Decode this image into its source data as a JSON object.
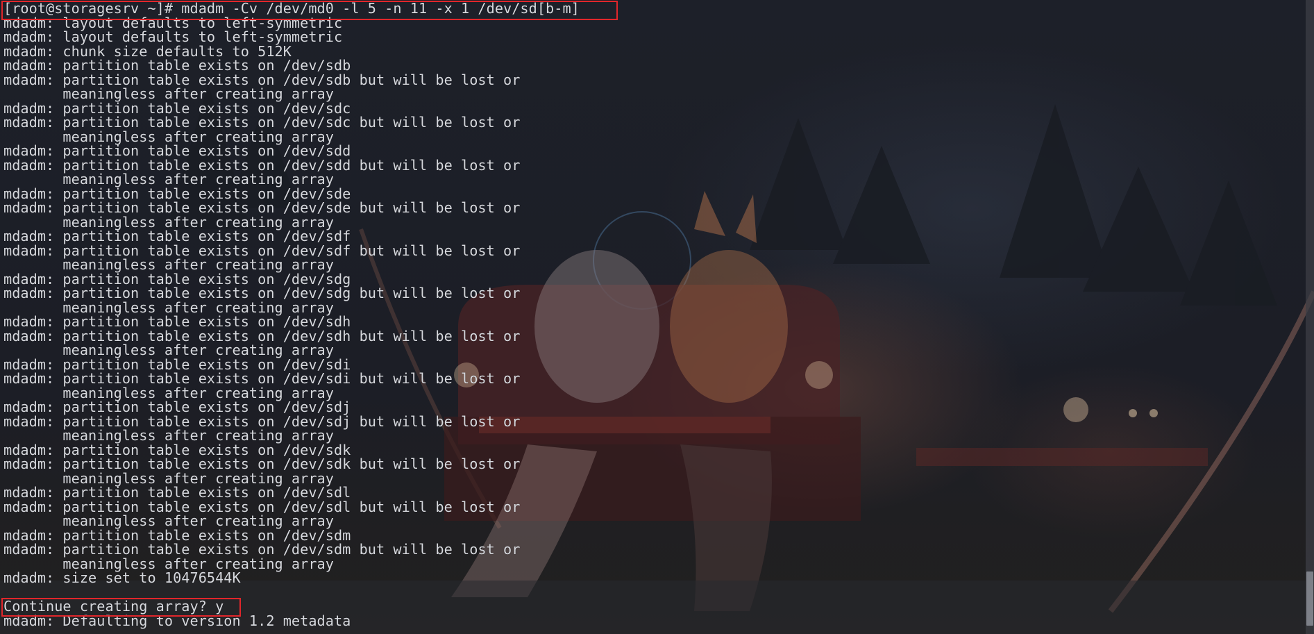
{
  "terminal": {
    "lines": [
      "[root@storagesrv ~]# mdadm -Cv /dev/md0 -l 5 -n 11 -x 1 /dev/sd[b-m]",
      "mdadm: layout defaults to left-symmetric",
      "mdadm: layout defaults to left-symmetric",
      "mdadm: chunk size defaults to 512K",
      "mdadm: partition table exists on /dev/sdb",
      "mdadm: partition table exists on /dev/sdb but will be lost or",
      "       meaningless after creating array",
      "mdadm: partition table exists on /dev/sdc",
      "mdadm: partition table exists on /dev/sdc but will be lost or",
      "       meaningless after creating array",
      "mdadm: partition table exists on /dev/sdd",
      "mdadm: partition table exists on /dev/sdd but will be lost or",
      "       meaningless after creating array",
      "mdadm: partition table exists on /dev/sde",
      "mdadm: partition table exists on /dev/sde but will be lost or",
      "       meaningless after creating array",
      "mdadm: partition table exists on /dev/sdf",
      "mdadm: partition table exists on /dev/sdf but will be lost or",
      "       meaningless after creating array",
      "mdadm: partition table exists on /dev/sdg",
      "mdadm: partition table exists on /dev/sdg but will be lost or",
      "       meaningless after creating array",
      "mdadm: partition table exists on /dev/sdh",
      "mdadm: partition table exists on /dev/sdh but will be lost or",
      "       meaningless after creating array",
      "mdadm: partition table exists on /dev/sdi",
      "mdadm: partition table exists on /dev/sdi but will be lost or",
      "       meaningless after creating array",
      "mdadm: partition table exists on /dev/sdj",
      "mdadm: partition table exists on /dev/sdj but will be lost or",
      "       meaningless after creating array",
      "mdadm: partition table exists on /dev/sdk",
      "mdadm: partition table exists on /dev/sdk but will be lost or",
      "       meaningless after creating array",
      "mdadm: partition table exists on /dev/sdl",
      "mdadm: partition table exists on /dev/sdl but will be lost or",
      "       meaningless after creating array",
      "mdadm: partition table exists on /dev/sdm",
      "mdadm: partition table exists on /dev/sdm but will be lost or",
      "       meaningless after creating array",
      "mdadm: size set to 10476544K",
      "Continue creating array? y",
      "mdadm: Defaulting to version 1.2 metadata"
    ]
  },
  "colors": {
    "text": "#d7d9de",
    "highlight_border": "#e1262b",
    "background": "#1c1e26"
  }
}
